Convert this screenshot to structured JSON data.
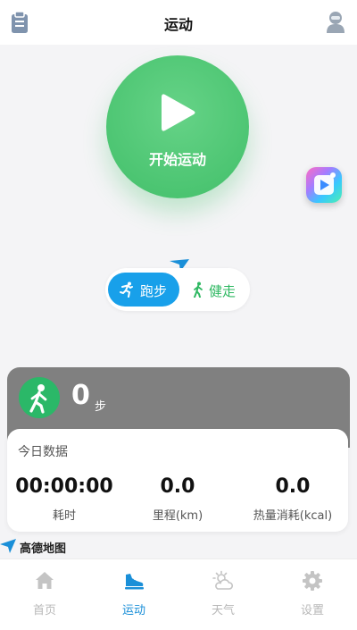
{
  "header": {
    "title": "运动"
  },
  "start_button": {
    "label": "开始运动"
  },
  "mode_toggle": {
    "run_label": "跑步",
    "walk_label": "健走",
    "selected": "跑步"
  },
  "steps": {
    "value": "0",
    "unit": "步"
  },
  "today": {
    "title": "今日数据",
    "stats": [
      {
        "value": "00:00:00",
        "label": "耗时"
      },
      {
        "value": "0.0",
        "label": "里程(km)"
      },
      {
        "value": "0.0",
        "label": "热量消耗(kcal)"
      }
    ]
  },
  "map_logo": {
    "text": "高德地图"
  },
  "tabbar": {
    "items": [
      {
        "label": "首页",
        "icon": "home-icon"
      },
      {
        "label": "运动",
        "icon": "running-shoe-icon"
      },
      {
        "label": "天气",
        "icon": "weather-icon"
      },
      {
        "label": "设置",
        "icon": "gear-icon"
      }
    ],
    "active": "运动"
  },
  "colors": {
    "accent_blue": "#18a0ea",
    "tab_active": "#1a8fd8",
    "start_green": "#4cc572",
    "walk_green": "#2fb862",
    "steps_card_bg": "#808080"
  }
}
